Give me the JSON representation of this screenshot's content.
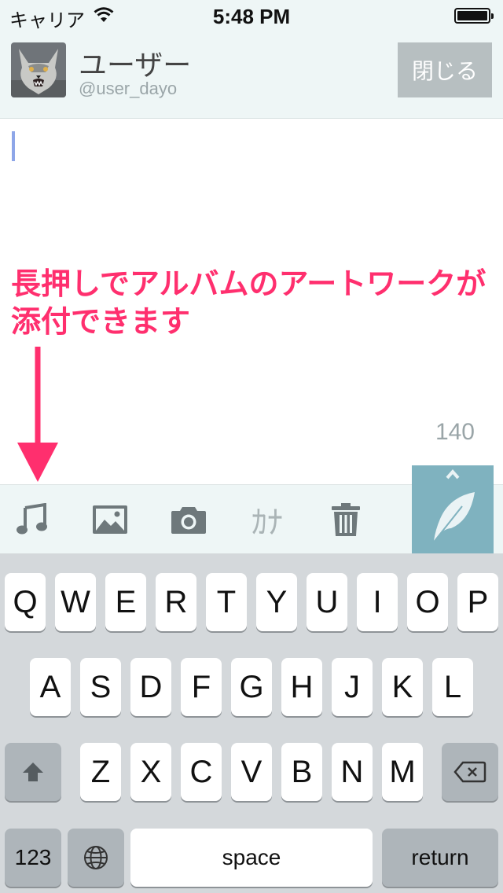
{
  "status_bar": {
    "carrier": "キャリア",
    "time": "5:48 PM"
  },
  "header": {
    "user_name": "ユーザー",
    "user_handle": "@user_dayo",
    "close_label": "閉じる"
  },
  "compose": {
    "annotation_line1": "長押しでアルバムのアートワークが",
    "annotation_line2": "添付できます",
    "char_count": "140"
  },
  "toolbar": {
    "kana_label": "ｶﾅ",
    "icons": [
      "music-note-icon",
      "image-icon",
      "camera-icon",
      "kana-icon",
      "trash-icon",
      "feather-icon",
      "chevron-up-icon"
    ]
  },
  "keyboard": {
    "row1": [
      "Q",
      "W",
      "E",
      "R",
      "T",
      "Y",
      "U",
      "I",
      "O",
      "P"
    ],
    "row2": [
      "A",
      "S",
      "D",
      "F",
      "G",
      "H",
      "J",
      "K",
      "L"
    ],
    "row3": [
      "Z",
      "X",
      "C",
      "V",
      "B",
      "N",
      "M"
    ],
    "numbers_label": "123",
    "space_label": "space",
    "return_label": "return"
  },
  "colors": {
    "annotation": "#ff2f6e",
    "send_button": "#7fb2bf",
    "header_bg": "#eef6f6"
  }
}
